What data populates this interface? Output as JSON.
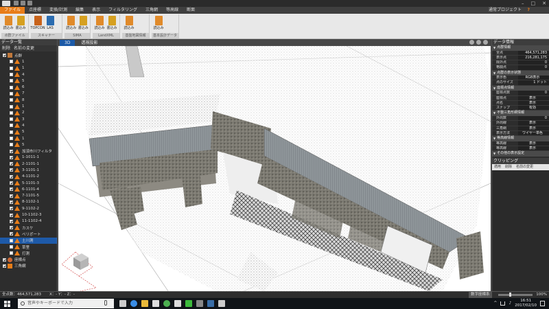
{
  "window": {
    "project": "通常プロジェクト",
    "help": "?"
  },
  "menu": [
    "ファイル",
    "点座標",
    "変換/計測",
    "編集",
    "表示",
    "フィルタリング",
    "三角網",
    "等高線",
    "断面"
  ],
  "ribbon": {
    "groups": [
      {
        "label": "点群ファイル",
        "buttons": [
          {
            "label": "読込み",
            "color": "#e08a2a"
          },
          {
            "label": "書込み",
            "color": "#d6a020"
          }
        ]
      },
      {
        "label": "スキャナー",
        "buttons": [
          {
            "label": "TOPCON",
            "color": "#c8631b"
          },
          {
            "label": "LAS",
            "color": "#2b6cb0"
          }
        ]
      },
      {
        "label": "SIMA",
        "buttons": [
          {
            "label": "読込み",
            "color": "#e08a2a"
          },
          {
            "label": "書込み",
            "color": "#d6a020"
          }
        ]
      },
      {
        "label": "LandXML",
        "buttons": [
          {
            "label": "読込み",
            "color": "#e08a2a"
          },
          {
            "label": "書込み",
            "color": "#d6a020"
          }
        ]
      },
      {
        "label": "基盤地図情報",
        "buttons": [
          {
            "label": "読込み",
            "color": "#e08a2a"
          }
        ]
      },
      {
        "label": "基本設計データ",
        "buttons": [
          {
            "label": "読込み",
            "color": "#e08a2a"
          }
        ]
      }
    ]
  },
  "left_panel": {
    "title": "データ一覧",
    "tools": [
      "削除",
      "名前の変更"
    ],
    "items": [
      {
        "label": "点群",
        "type": "cube",
        "checked": true
      },
      {
        "label": "1",
        "type": "tri",
        "checked": false
      },
      {
        "label": "1",
        "type": "tri",
        "checked": false
      },
      {
        "label": "4",
        "type": "tri",
        "checked": false
      },
      {
        "label": "5",
        "type": "tri",
        "checked": false
      },
      {
        "label": "6",
        "type": "tri",
        "checked": false
      },
      {
        "label": "7",
        "type": "tri",
        "checked": false
      },
      {
        "label": "8",
        "type": "tri",
        "checked": false
      },
      {
        "label": "1",
        "type": "tri",
        "checked": false
      },
      {
        "label": "2",
        "type": "tri",
        "checked": false
      },
      {
        "label": "3",
        "type": "tri",
        "checked": false
      },
      {
        "label": "4",
        "type": "tri",
        "checked": false
      },
      {
        "label": "5",
        "type": "tri",
        "checked": false
      },
      {
        "label": "1",
        "type": "tri",
        "checked": false
      },
      {
        "label": "5",
        "type": "tri",
        "checked": false
      },
      {
        "label": "加須市川フィルタ",
        "type": "tri",
        "checked": true
      },
      {
        "label": "1-1011-1",
        "type": "tri",
        "checked": true
      },
      {
        "label": "2-1101-1",
        "type": "tri",
        "checked": true
      },
      {
        "label": "3-1101-1",
        "type": "tri",
        "checked": true
      },
      {
        "label": "4-1101-2",
        "type": "tri",
        "checked": true
      },
      {
        "label": "5-1101-3",
        "type": "tri",
        "checked": true
      },
      {
        "label": "6-1101-4",
        "type": "tri",
        "checked": true
      },
      {
        "label": "7-1101-5",
        "type": "tri",
        "checked": true
      },
      {
        "label": "8-1102-1",
        "type": "tri",
        "checked": true
      },
      {
        "label": "9-1102-2",
        "type": "tri",
        "checked": true
      },
      {
        "label": "10-1102-3",
        "type": "tri",
        "checked": true
      },
      {
        "label": "11-1102-4",
        "type": "tri",
        "checked": true
      },
      {
        "label": "カスケ",
        "type": "tri",
        "checked": true
      },
      {
        "label": "ベリポート",
        "type": "tri",
        "checked": true
      },
      {
        "label": "土川測",
        "type": "tri",
        "checked": false,
        "selected": true
      },
      {
        "label": "草里",
        "type": "tri",
        "checked": false
      },
      {
        "label": "打測",
        "type": "tri",
        "checked": false
      },
      {
        "label": "座標点",
        "type": "pts",
        "checked": true
      },
      {
        "label": "三角網",
        "type": "mesh",
        "checked": true
      }
    ]
  },
  "view_tabs": [
    {
      "label": "3D",
      "active": true
    },
    {
      "label": "透視投影",
      "active": false
    }
  ],
  "right_panel": {
    "title": "データ情報",
    "sections": [
      {
        "title": "点群情報",
        "props": [
          [
            "全点",
            "464,571,283"
          ],
          [
            "表示点",
            "216,281,175"
          ],
          [
            "除外点",
            "0"
          ],
          [
            "格闘点",
            "0"
          ]
        ]
      },
      {
        "title": "点群の表示状態",
        "props": [
          [
            "表示色",
            "RGB表示"
          ],
          [
            "点のサイズ",
            "1 ドット"
          ]
        ]
      },
      {
        "title": "座標点情報",
        "props": [
          [
            "座標点数",
            "0"
          ],
          [
            "座標点",
            "表示"
          ],
          [
            "点名",
            "表示"
          ],
          [
            "スナップ",
            "有効"
          ]
        ]
      },
      {
        "title": "不整三角形網情報",
        "props": [
          [
            "外周数",
            "0"
          ],
          [
            "外周線",
            "表示"
          ],
          [
            "三角網",
            "表示"
          ],
          [
            "表示方法",
            "ワイヤー単色"
          ]
        ]
      },
      {
        "title": "等高線情報",
        "props": [
          [
            "等高線",
            "表示"
          ],
          [
            "等高線",
            "表示"
          ]
        ]
      },
      {
        "title": "その他の表示設定",
        "props": []
      }
    ],
    "clipping_title": "クリッピング",
    "clipping_tools": [
      "適用",
      "削除",
      "名前の変更"
    ]
  },
  "status": {
    "count": "全点数：464,571,283",
    "coord": "X：-  Y：-  Z：-",
    "mode": "数字座標系",
    "zoom": "100%"
  },
  "taskbar": {
    "search_placeholder": "ここに入力して検索",
    "search_text": "音声やキーボードで入力",
    "time": "16:51",
    "date": "2017/02/10",
    "icons": [
      "task-view",
      "edge",
      "explorer",
      "store",
      "chrome",
      "file",
      "line",
      "app",
      "pc",
      "app2"
    ]
  }
}
